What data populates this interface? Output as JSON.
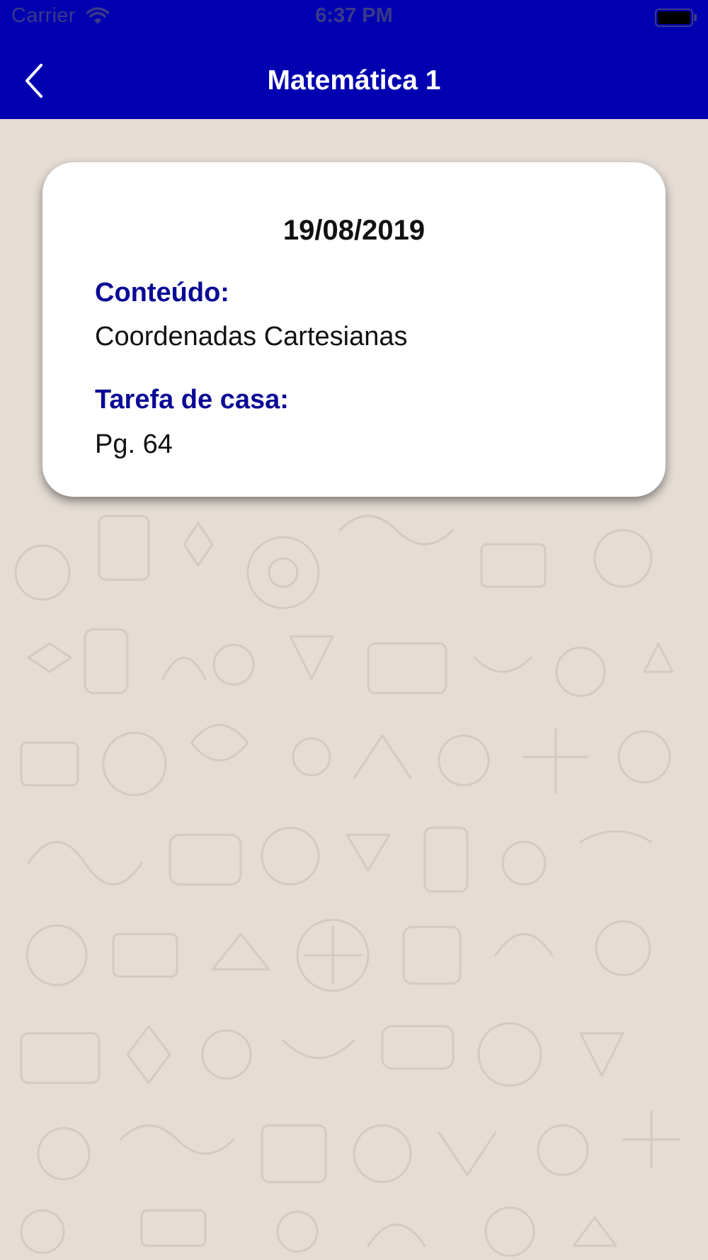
{
  "status_bar": {
    "carrier": "Carrier",
    "time": "6:37 PM",
    "wifi_icon": "wifi-icon",
    "battery_icon": "battery-icon"
  },
  "nav": {
    "title": "Matemática 1",
    "back_icon": "chevron-left-icon"
  },
  "lesson": {
    "date": "19/08/2019",
    "content_label": "Conteúdo:",
    "content_value": "Coordenadas Cartesianas",
    "homework_label": "Tarefa de casa:",
    "homework_value": "Pg. 64"
  },
  "colors": {
    "nav_background": "#0000b0",
    "label_color": "#0a0a96",
    "page_background": "#e5ddd5"
  }
}
